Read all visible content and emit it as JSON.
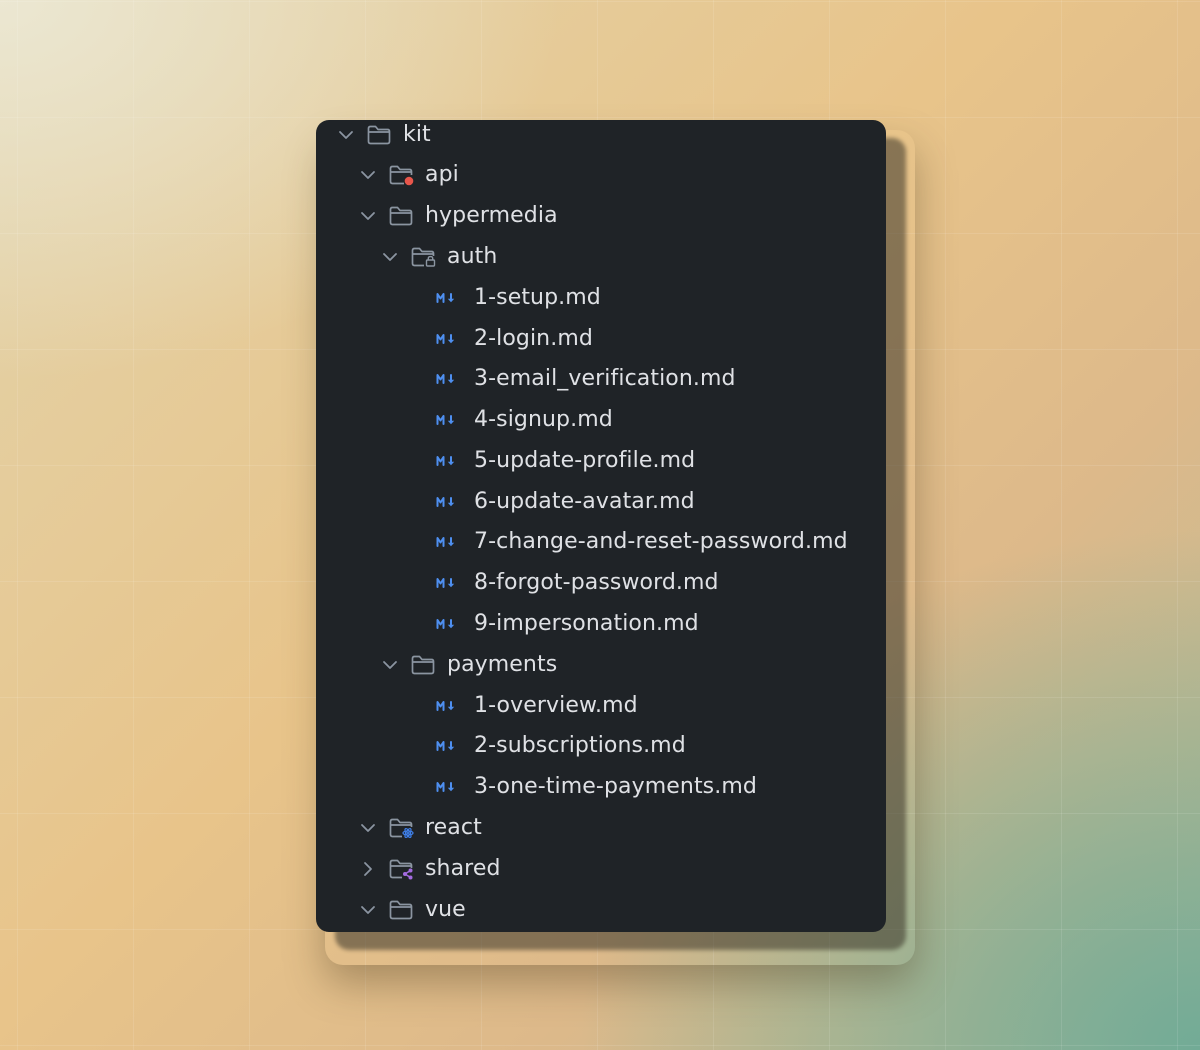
{
  "colors": {
    "panel_bg": "#1f2327",
    "text": "#dfe1e5",
    "icon_gray": "#8b95a1",
    "markdown_blue": "#4e8ff0",
    "api_dot": "#e8564b",
    "react_blue": "#3f7fe8",
    "shared_purple": "#a36be0"
  },
  "tree": {
    "kit": {
      "label": "kit",
      "expanded": true,
      "icon": "folder-icon"
    },
    "api": {
      "label": "api",
      "expanded": true,
      "icon": "folder-api-icon"
    },
    "hypermedia": {
      "label": "hypermedia",
      "expanded": true,
      "icon": "folder-icon"
    },
    "auth": {
      "label": "auth",
      "expanded": true,
      "icon": "folder-locked-icon"
    },
    "auth_files": [
      {
        "label": "1-setup.md",
        "icon": "markdown-icon"
      },
      {
        "label": "2-login.md",
        "icon": "markdown-icon"
      },
      {
        "label": "3-email_verification.md",
        "icon": "markdown-icon"
      },
      {
        "label": "4-signup.md",
        "icon": "markdown-icon"
      },
      {
        "label": "5-update-profile.md",
        "icon": "markdown-icon"
      },
      {
        "label": "6-update-avatar.md",
        "icon": "markdown-icon"
      },
      {
        "label": "7-change-and-reset-password.md",
        "icon": "markdown-icon"
      },
      {
        "label": "8-forgot-password.md",
        "icon": "markdown-icon"
      },
      {
        "label": "9-impersonation.md",
        "icon": "markdown-icon"
      }
    ],
    "payments": {
      "label": "payments",
      "expanded": true,
      "icon": "folder-icon"
    },
    "payments_files": [
      {
        "label": "1-overview.md",
        "icon": "markdown-icon"
      },
      {
        "label": "2-subscriptions.md",
        "icon": "markdown-icon"
      },
      {
        "label": "3-one-time-payments.md",
        "icon": "markdown-icon"
      }
    ],
    "react": {
      "label": "react",
      "expanded": true,
      "icon": "folder-react-icon"
    },
    "shared": {
      "label": "shared",
      "expanded": false,
      "icon": "folder-shared-icon"
    },
    "vue": {
      "label": "vue",
      "expanded": true,
      "icon": "folder-icon"
    }
  }
}
